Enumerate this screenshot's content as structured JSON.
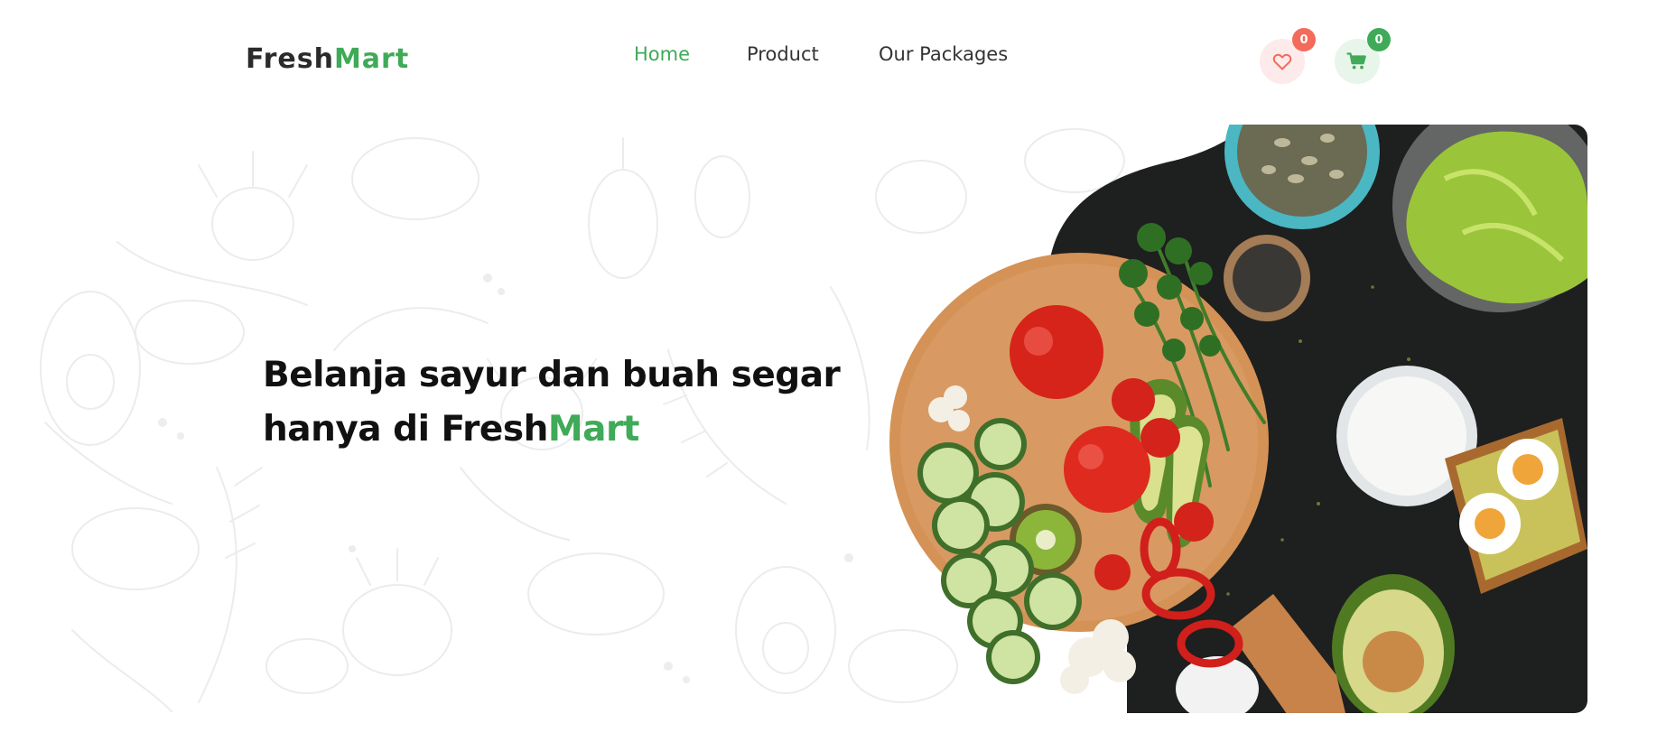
{
  "brand": {
    "name_part1": "Fresh",
    "name_part2": "Mart",
    "accent_color": "#3faa57"
  },
  "nav": {
    "items": [
      {
        "label": "Home",
        "active": true
      },
      {
        "label": "Product",
        "active": false
      },
      {
        "label": "Our Packages",
        "active": false
      }
    ]
  },
  "header_actions": {
    "wishlist": {
      "icon": "heart-icon",
      "count": "0",
      "badge_color": "#f26b5b"
    },
    "cart": {
      "icon": "cart-icon",
      "count": "0",
      "badge_color": "#3faa57"
    }
  },
  "hero": {
    "headline_line1": "Belanja sayur dan buah segar",
    "headline_line2_prefix": "hanya di ",
    "headline_brand_part1": "Fresh",
    "headline_brand_part2": "Mart"
  }
}
